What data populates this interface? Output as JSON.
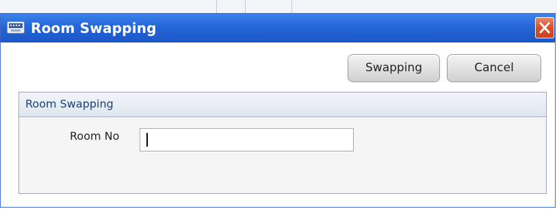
{
  "window": {
    "title": "Room Swapping",
    "title_icon": "keyboard-icon",
    "close_icon": "close-icon",
    "titlebar_color": "#2466d8",
    "close_color": "#d9532b"
  },
  "toolbar": {
    "swap_label": "Swapping",
    "cancel_label": "Cancel"
  },
  "panel": {
    "title": "Room Swapping",
    "room_no_label": "Room No",
    "room_no_value": "",
    "room_no_placeholder": ""
  }
}
